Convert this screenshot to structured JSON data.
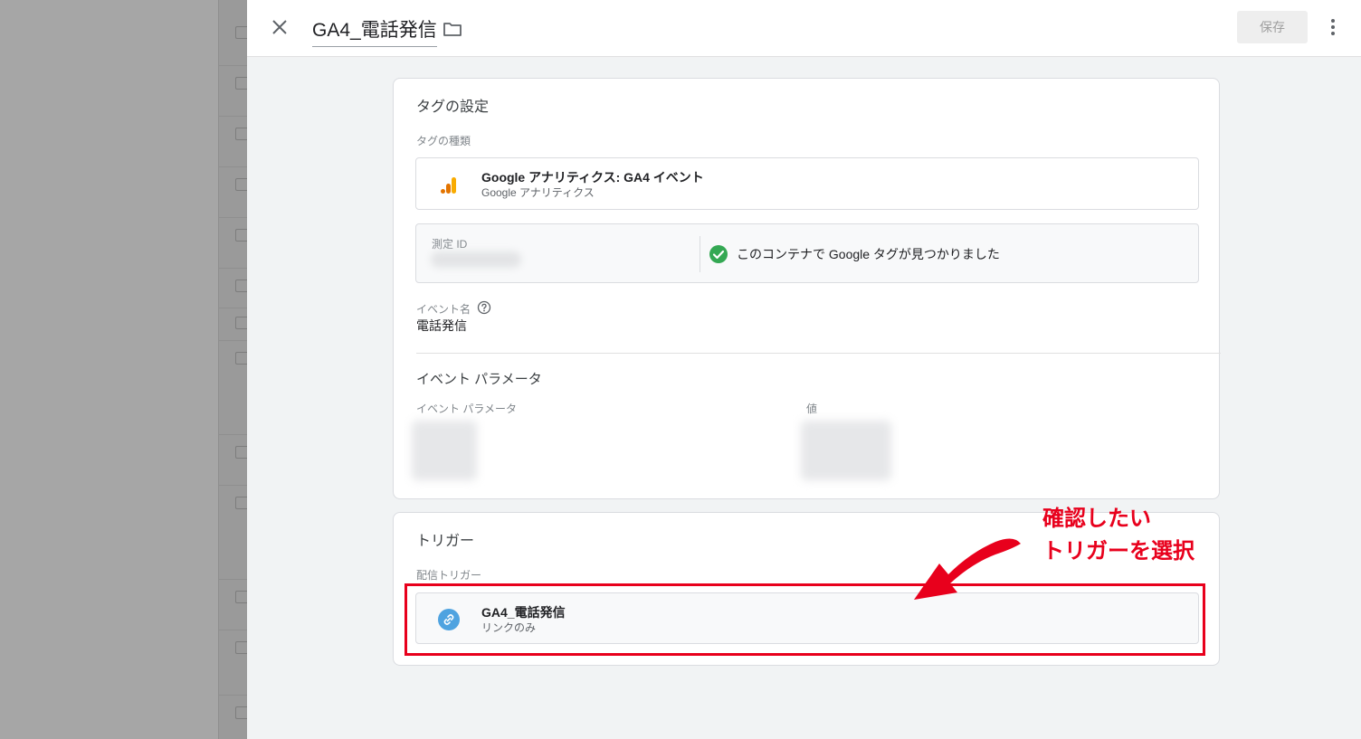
{
  "header": {
    "title": "GA4_電話発信",
    "save_label": "保存"
  },
  "tag_config": {
    "title": "タグの設定",
    "type_label": "タグの種類",
    "type_name": "Google アナリティクス: GA4 イベント",
    "type_sub": "Google アナリティクス",
    "measurement_id_label": "測定 ID",
    "found_text": "このコンテナで Google タグが見つかりました",
    "event_name_label": "イベント名",
    "event_name_value": "電話発信",
    "params_section_title": "イベント パラメータ",
    "params_col_param": "イベント パラメータ",
    "params_col_value": "値"
  },
  "triggers": {
    "title": "トリガー",
    "firing_label": "配信トリガー",
    "items": [
      {
        "name": "GA4_電話発信",
        "sub": "リンクのみ"
      }
    ]
  },
  "annotation": {
    "line1": "確認したい",
    "line2": "トリガーを選択"
  },
  "colors": {
    "annotation_red": "#e8001c",
    "ga_orange": "#f9ab00",
    "ga_dark_orange": "#e37400",
    "check_green": "#34a853",
    "link_blue": "#4fa3e0"
  },
  "icons": {
    "close": "close-icon",
    "folder": "folder-icon",
    "more": "more-vert-icon",
    "analytics": "analytics-icon",
    "check": "check-circle-icon",
    "help": "help-icon",
    "link": "link-icon"
  }
}
